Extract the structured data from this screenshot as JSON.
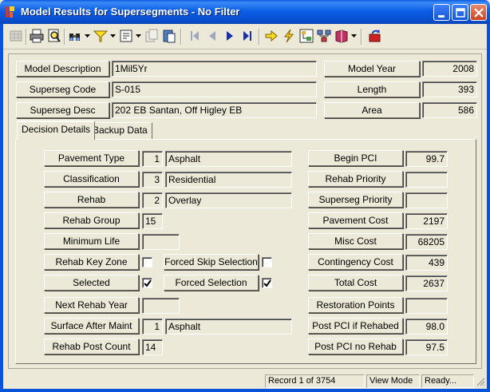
{
  "window": {
    "title": "Model Results for Supersegments - No Filter",
    "titlebar_color": "#0853d9"
  },
  "toolbar": {
    "icons": [
      "grid-icon",
      "print-icon",
      "print-preview-icon",
      "binoculars-icon",
      "filter-icon",
      "form-icon",
      "copy-icon",
      "paste-icon",
      "first-record-icon",
      "prev-record-icon",
      "next-record-icon",
      "last-record-icon",
      "goto-arrow-icon",
      "lightning-icon",
      "tree-icon",
      "network-icon",
      "book-icon",
      "exit-icon"
    ]
  },
  "header": {
    "model_description_label": "Model Description",
    "model_description_value": "1Mil5Yr",
    "superseg_code_label": "Superseg Code",
    "superseg_code_value": "S-015",
    "superseg_desc_label": "Superseg Desc",
    "superseg_desc_value": "202 EB Santan, Off Higley EB",
    "model_year_label": "Model Year",
    "model_year_value": "2008",
    "length_label": "Length",
    "length_value": "393",
    "area_label": "Area",
    "area_value": "586"
  },
  "tabs": [
    {
      "label": "Decision Details",
      "active": true
    },
    {
      "label": "Backup Data",
      "active": false
    }
  ],
  "details": {
    "pavement_type_label": "Pavement Type",
    "pavement_type_code": "1",
    "pavement_type_value": "Asphalt",
    "classification_label": "Classification",
    "classification_code": "3",
    "classification_value": "Residential",
    "rehab_label": "Rehab",
    "rehab_code": "2",
    "rehab_value": "Overlay",
    "rehab_group_label": "Rehab Group",
    "rehab_group_value": "15",
    "minimum_life_label": "Minimum Life",
    "minimum_life_value": "",
    "rehab_key_zone_label": "Rehab Key Zone",
    "rehab_key_zone_checked": false,
    "forced_skip_label": "Forced Skip Selection",
    "forced_skip_checked": false,
    "selected_label": "Selected",
    "selected_checked": true,
    "forced_selection_label": "Forced Selection",
    "forced_selection_checked": true,
    "next_rehab_year_label": "Next Rehab Year",
    "next_rehab_year_value": "",
    "surface_after_label": "Surface After Maint",
    "surface_after_code": "1",
    "surface_after_value": "Asphalt",
    "rehab_post_count_label": "Rehab Post Count",
    "rehab_post_count_value": "14",
    "begin_pci_label": "Begin PCI",
    "begin_pci_value": "99.7",
    "rehab_priority_label": "Rehab Priority",
    "rehab_priority_value": "",
    "superseg_priority_label": "Superseg Priority",
    "superseg_priority_value": "",
    "pavement_cost_label": "Pavement Cost",
    "pavement_cost_value": "2197",
    "misc_cost_label": "Misc Cost",
    "misc_cost_value": "68205",
    "contingency_cost_label": "Contingency Cost",
    "contingency_cost_value": "439",
    "total_cost_label": "Total Cost",
    "total_cost_value": "2637",
    "restoration_points_label": "Restoration Points",
    "restoration_points_value": "",
    "post_pci_rehabed_label": "Post PCI if Rehabed",
    "post_pci_rehabed_value": "98.0",
    "post_pci_no_rehab_label": "Post PCI no Rehab",
    "post_pci_no_rehab_value": "97.5"
  },
  "status": {
    "record": "Record 1 of 3754",
    "mode": "View Mode",
    "state": "Ready..."
  }
}
